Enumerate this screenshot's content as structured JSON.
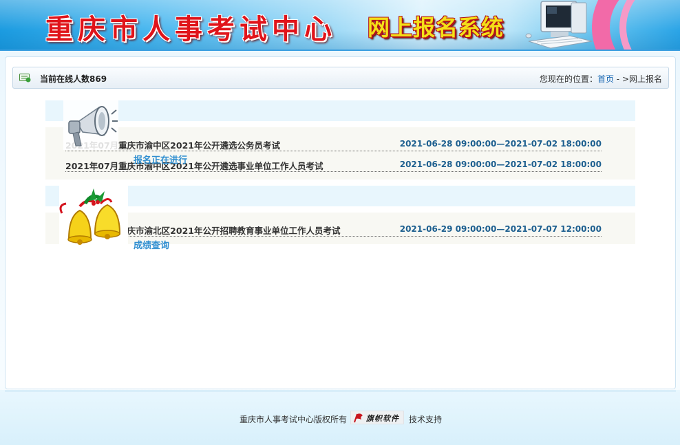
{
  "header": {
    "site_title": "重庆市人事考试中心",
    "system_title": "网上报名系统"
  },
  "topbar": {
    "online_text": "当前在线人数869",
    "location_label": "您现在的位置：",
    "home_link": "首页",
    "location_tail": " - >网上报名"
  },
  "sections": [
    {
      "label": "报名正在进行",
      "icon": "megaphone-icon",
      "exams": [
        {
          "name": "2021年07月重庆市渝中区2021年公开遴选公务员考试",
          "period": "2021-06-28 09:00:00—2021-07-02 18:00:00"
        },
        {
          "name": "2021年07月重庆市渝中区2021年公开遴选事业单位工作人员考试",
          "period": "2021-06-28 09:00:00—2021-07-02 18:00:00"
        }
      ]
    },
    {
      "label": "成绩查询",
      "icon": "bells-icon",
      "exams": [
        {
          "name": "2021年07月重庆市渝北区2021年公开招聘教育事业单位工作人员考试",
          "period": "2021-06-29 09:00:00—2021-07-07 12:00:00"
        }
      ]
    }
  ],
  "footer": {
    "copyright": "重庆市人事考试中心版权所有",
    "brand": "旗帜软件",
    "tech_support": "技术支持"
  },
  "colors": {
    "header_blue": "#1b9be0",
    "title_red": "#e0141a",
    "link_blue": "#1666b2",
    "period_blue": "#1d5f8f",
    "category_blue": "#2f8ed0"
  }
}
